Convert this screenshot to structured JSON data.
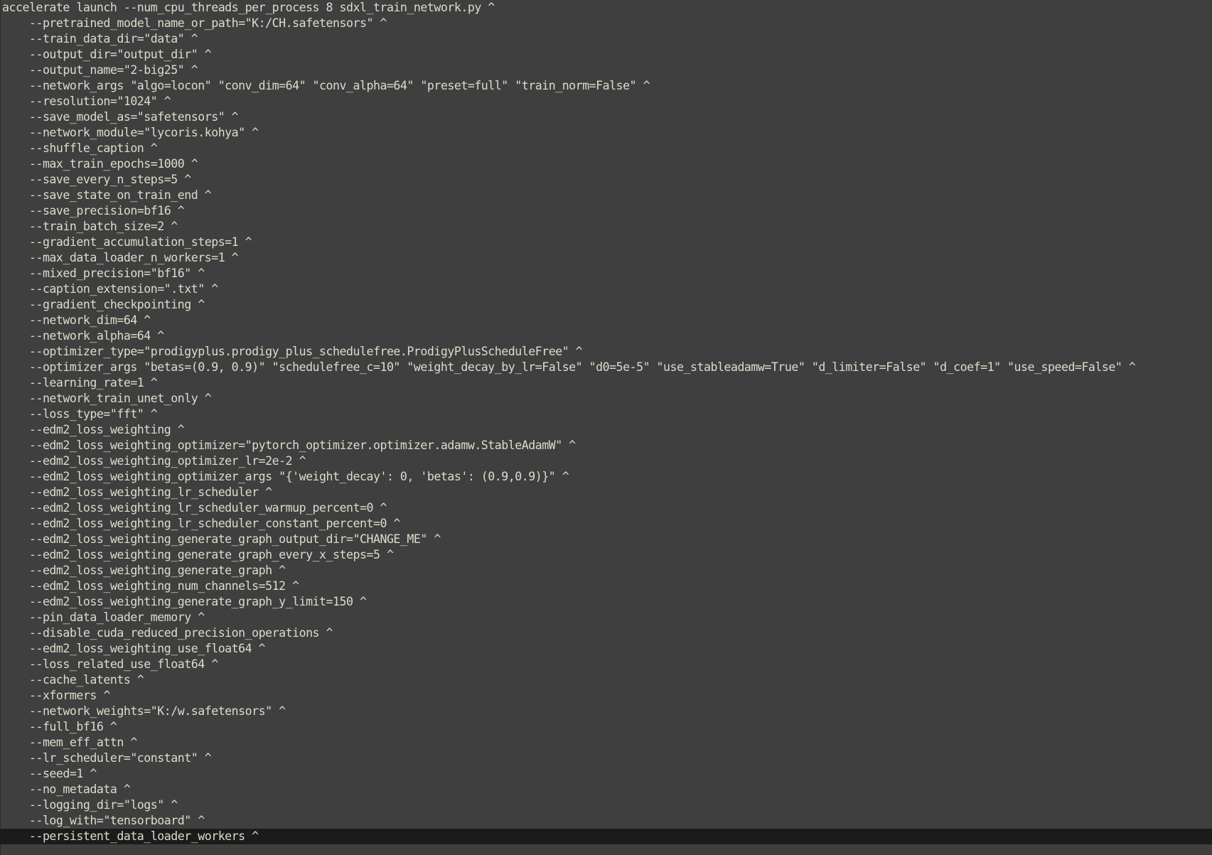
{
  "editor": {
    "lines": [
      "accelerate launch --num_cpu_threads_per_process 8 sdxl_train_network.py ^",
      "    --pretrained_model_name_or_path=\"K:/CH.safetensors\" ^",
      "    --train_data_dir=\"data\" ^",
      "    --output_dir=\"output_dir\" ^",
      "    --output_name=\"2-big25\" ^",
      "    --network_args \"algo=locon\" \"conv_dim=64\" \"conv_alpha=64\" \"preset=full\" \"train_norm=False\" ^",
      "    --resolution=\"1024\" ^",
      "    --save_model_as=\"safetensors\" ^",
      "    --network_module=\"lycoris.kohya\" ^",
      "    --shuffle_caption ^",
      "    --max_train_epochs=1000 ^",
      "    --save_every_n_steps=5 ^",
      "    --save_state_on_train_end ^",
      "    --save_precision=bf16 ^",
      "    --train_batch_size=2 ^",
      "    --gradient_accumulation_steps=1 ^",
      "    --max_data_loader_n_workers=1 ^",
      "    --mixed_precision=\"bf16\" ^",
      "    --caption_extension=\".txt\" ^",
      "    --gradient_checkpointing ^",
      "    --network_dim=64 ^",
      "    --network_alpha=64 ^",
      "    --optimizer_type=\"prodigyplus.prodigy_plus_schedulefree.ProdigyPlusScheduleFree\" ^",
      "    --optimizer_args \"betas=(0.9, 0.9)\" \"schedulefree_c=10\" \"weight_decay_by_lr=False\" \"d0=5e-5\" \"use_stableadamw=True\" \"d_limiter=False\" \"d_coef=1\" \"use_speed=False\" ^",
      "    --learning_rate=1 ^",
      "    --network_train_unet_only ^",
      "    --loss_type=\"fft\" ^",
      "    --edm2_loss_weighting ^",
      "    --edm2_loss_weighting_optimizer=\"pytorch_optimizer.optimizer.adamw.StableAdamW\" ^",
      "    --edm2_loss_weighting_optimizer_lr=2e-2 ^",
      "    --edm2_loss_weighting_optimizer_args \"{'weight_decay': 0, 'betas': (0.9,0.9)}\" ^",
      "    --edm2_loss_weighting_lr_scheduler ^",
      "    --edm2_loss_weighting_lr_scheduler_warmup_percent=0 ^",
      "    --edm2_loss_weighting_lr_scheduler_constant_percent=0 ^",
      "    --edm2_loss_weighting_generate_graph_output_dir=\"CHANGE_ME\" ^",
      "    --edm2_loss_weighting_generate_graph_every_x_steps=5 ^",
      "    --edm2_loss_weighting_generate_graph ^",
      "    --edm2_loss_weighting_num_channels=512 ^",
      "    --edm2_loss_weighting_generate_graph_y_limit=150 ^",
      "    --pin_data_loader_memory ^",
      "    --disable_cuda_reduced_precision_operations ^",
      "    --edm2_loss_weighting_use_float64 ^",
      "    --loss_related_use_float64 ^",
      "    --cache_latents ^",
      "    --xformers ^",
      "    --network_weights=\"K:/w.safetensors\" ^",
      "    --full_bf16 ^",
      "    --mem_eff_attn ^",
      "    --lr_scheduler=\"constant\" ^",
      "    --seed=1 ^",
      "    --no_metadata ^",
      "    --logging_dir=\"logs\" ^",
      "    --log_with=\"tensorboard\" ^",
      "    --persistent_data_loader_workers ^"
    ]
  },
  "colors": {
    "background": "#3f3f3f",
    "text": "#dcdccc",
    "current_line": "#1b1b1b"
  }
}
